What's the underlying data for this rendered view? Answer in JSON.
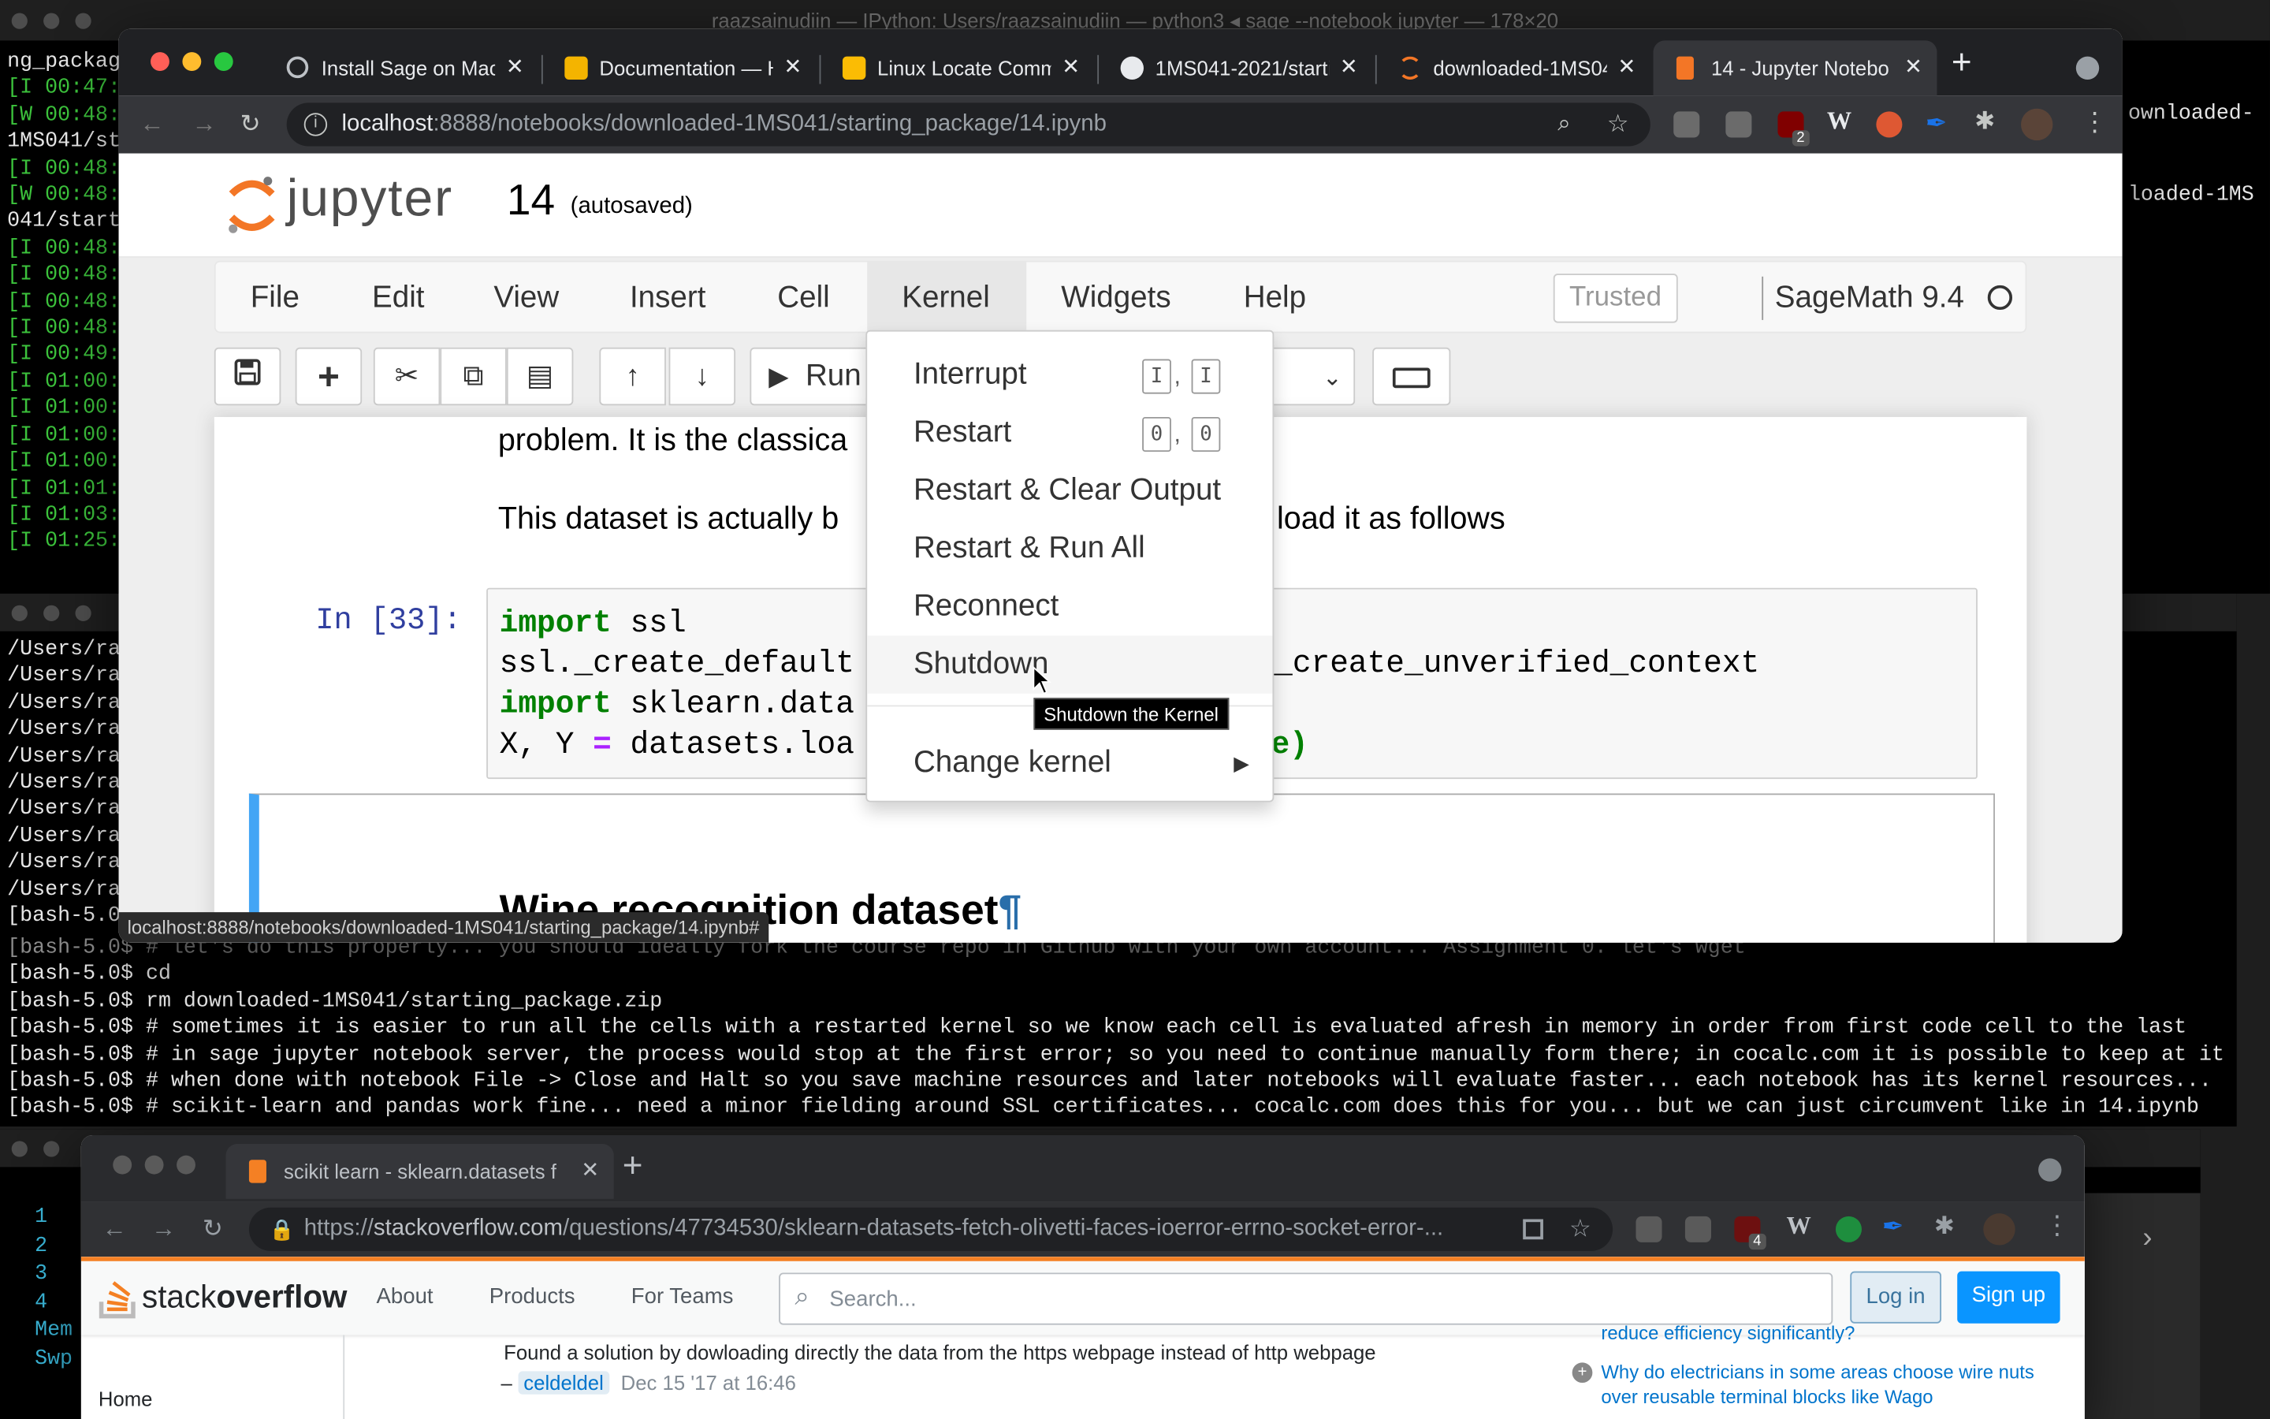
{
  "terminal_back": {
    "title": "raazsainudiin — IPython: Users/raazsainudiin — python3 ◂ sage --notebook jupyter — 178×20",
    "left_lines": [
      "ng_packag",
      "[I 00:47:",
      "[W 00:48:",
      "1MS041/st",
      "[I 00:48:",
      "[W 00:48:",
      "041/start",
      "[I 00:48:",
      "[I 00:48:",
      "[I 00:48:",
      "[I 00:48:",
      "[I 00:49:",
      "[I 01:00:",
      "[I 01:00:",
      "[I 01:00:",
      "[I 01:00:",
      "[I 01:01:",
      "[I 01:03:",
      "[I 01:25:"
    ],
    "right_lines": [
      "ownloaded-",
      "loaded-1MS"
    ]
  },
  "terminal_mid": {
    "left_lines": [
      "/Users/ra",
      "/Users/ra",
      "/Users/ra",
      "/Users/ra",
      "/Users/ra",
      "/Users/ra",
      "/Users/ra",
      "/Users/ra",
      "/Users/ra",
      "/Users/ra",
      "[bash-5.0$"
    ],
    "bash_lines": [
      "[bash-5.0$ # let's do this properly... you should ideally fork the course repo in Github with your own account... Assignment 0. let's wget",
      "[bash-5.0$ cd",
      "[bash-5.0$ rm downloaded-1MS041/starting_package.zip",
      "[bash-5.0$ # sometimes it is easier to run all the cells with a restarted kernel so we know each cell is evaluated afresh in memory in order from first code cell to the last",
      "[bash-5.0$ # in sage jupyter notebook server, the process would stop at the first error; so you need to continue manually form there; in cocalc.com it is possible to keep at it",
      "[bash-5.0$ # when done with notebook File -> Close and Halt so you save machine resources and later notebooks will evaluate faster... each notebook has its kernel resources...",
      "[bash-5.0$ # scikit-learn and pandas work fine... need a minor fielding around SSL certificates... cocalc.com does this for you... but we can just circumvent like in 14.ipynb"
    ]
  },
  "terminal_bottom": {
    "lines": [
      "1",
      "2",
      "3",
      "4",
      "Mem",
      "Swp"
    ]
  },
  "chrome_top": {
    "tabs": [
      {
        "label": "Install Sage on Mac",
        "icon": "globe-icon"
      },
      {
        "label": "Documentation — H",
        "icon": "beer-icon"
      },
      {
        "label": "Linux Locate Comm",
        "icon": "bulb-icon"
      },
      {
        "label": "1MS041-2021/starti",
        "icon": "github-icon"
      },
      {
        "label": "downloaded-1MS04",
        "icon": "jupyter-icon"
      },
      {
        "label": "14 - Jupyter Notebo",
        "icon": "notebook-icon"
      }
    ],
    "url_host": "localhost",
    "url_rest": ":8888/notebooks/downloaded-1MS041/starting_package/14.ipynb",
    "status_url": "localhost:8888/notebooks/downloaded-1MS041/starting_package/14.ipynb#",
    "ext_badge": "2"
  },
  "jupyter": {
    "logo_text": "jupyter",
    "notebook_name": "14",
    "autosaved": "(autosaved)",
    "menu": [
      "File",
      "Edit",
      "View",
      "Insert",
      "Cell",
      "Kernel",
      "Widgets",
      "Help"
    ],
    "trusted": "Trusted",
    "kernel_name": "SageMath 9.4",
    "run_label": "Run",
    "text_line1": "problem. It is the classica",
    "text_line2a": "This dataset is actually b",
    "text_line2b": "load it as follows",
    "prompt": "In [33]:",
    "code": {
      "l1_kw": "import",
      "l1_rest": " ssl",
      "l2a": "ssl._create_default",
      "l2b": "._create_unverified_context",
      "l3_kw": "import",
      "l3_rest": " sklearn.data",
      "l4a": "X, Y ",
      "l4_op": "=",
      "l4b": " datasets.loa",
      "l4c": "ue)"
    },
    "heading": "Wine recognition dataset",
    "heading_anchor": "¶",
    "kernel_menu": {
      "items": [
        "Interrupt",
        "Restart",
        "Restart & Clear Output",
        "Restart & Run All",
        "Reconnect",
        "Shutdown",
        "Change kernel"
      ],
      "interrupt_keys": [
        "I",
        "I"
      ],
      "restart_keys": [
        "0",
        "0"
      ],
      "tooltip": "Shutdown the Kernel"
    }
  },
  "chrome_bottom": {
    "tab_label": "scikit learn - sklearn.datasets f",
    "url_prefix": "https://",
    "url_host": "stackoverflow.com",
    "url_rest": "/questions/47734530/sklearn-datasets-fetch-olivetti-faces-ioerror-errno-socket-error-...",
    "ext_badge": "4",
    "so": {
      "logo_a": "stack",
      "logo_b": "overflow",
      "nav": [
        "About",
        "Products",
        "For Teams"
      ],
      "search_placeholder": "Search...",
      "login": "Log in",
      "signup": "Sign up",
      "home": "Home",
      "comment": "Found a solution by dowloading directly the data from the https webpage instead of http webpage",
      "comment_dash": "–",
      "comment_user": "celdeldel",
      "comment_date": "Dec 15 '17 at 16:46",
      "side_q1": "reduce efficiency significantly?",
      "side_q2": "Why do electricians in some areas choose wire nuts over reusable terminal blocks like Wago"
    }
  },
  "colors": {
    "jupyter_orange": "#f37626",
    "so_orange": "#f48024",
    "so_blue": "#0a95ff",
    "code_keyword": "#008000",
    "code_operator": "#aa22ff",
    "terminal_green": "#3cc23c",
    "cell_selected_border": "#42a5f5"
  }
}
